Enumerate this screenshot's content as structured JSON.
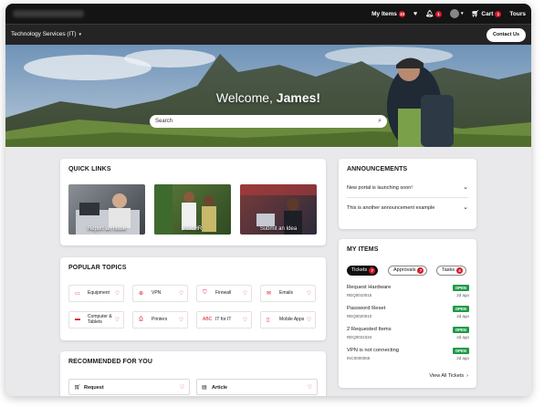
{
  "topbar": {
    "my_items_label": "My Items",
    "my_items_count": "10",
    "notif_count": "1",
    "cart_label": "Cart",
    "cart_count": "1",
    "tours_label": "Tours"
  },
  "subbar": {
    "department": "Technology Services (IT)",
    "contact_label": "Contact Us"
  },
  "hero": {
    "welcome_prefix": "Welcome,",
    "user_name": "James!",
    "search_placeholder": "Search"
  },
  "quick_links": {
    "title": "QUICK LINKS",
    "items": [
      {
        "label": "Report an Issue"
      },
      {
        "label": "Ask HR"
      },
      {
        "label": "Submit an Idea"
      }
    ]
  },
  "popular_topics": {
    "title": "POPULAR TOPICS",
    "items": [
      {
        "label": "Equipment",
        "icon": "monitor-icon"
      },
      {
        "label": "VPN",
        "icon": "globe-icon"
      },
      {
        "label": "Firewall",
        "icon": "shield-icon"
      },
      {
        "label": "Emails",
        "icon": "envelope-icon"
      },
      {
        "label": "Computer & Tablets",
        "icon": "laptop-icon"
      },
      {
        "label": "Printers",
        "icon": "printer-icon"
      },
      {
        "label": "IT for IT",
        "icon": "code-icon"
      },
      {
        "label": "Mobile Apps",
        "icon": "mobile-icon"
      }
    ]
  },
  "recommended": {
    "title": "RECOMMENDED FOR YOU",
    "items": [
      {
        "label": "Request",
        "icon": "cart-icon"
      },
      {
        "label": "Article",
        "icon": "document-icon"
      }
    ]
  },
  "announcements": {
    "title": "ANNOUNCEMENTS",
    "items": [
      {
        "label": "New portal is launching soon!"
      },
      {
        "label": "This is another announcement example"
      }
    ]
  },
  "my_items": {
    "title": "MY ITEMS",
    "tabs": [
      {
        "label": "Tickets",
        "count": "7"
      },
      {
        "label": "Approvals",
        "count": "7"
      },
      {
        "label": "Tasks",
        "count": "4"
      }
    ],
    "items": [
      {
        "name": "Request Hardware",
        "id": "REQ0010015",
        "status": "OPEN",
        "age": "2d ago"
      },
      {
        "name": "Password Reset",
        "id": "REQ0020010",
        "status": "OPEN",
        "age": "2d ago"
      },
      {
        "name": "2 Requested Items",
        "id": "REQ0031034",
        "status": "OPEN",
        "age": "2d ago"
      },
      {
        "name": "VPN is not connecting",
        "id": "INC0000065",
        "status": "OPEN",
        "age": "2d ago"
      }
    ],
    "view_all_label": "View All Tickets"
  },
  "colors": {
    "accent": "#d7192a",
    "open_status": "#1f9a4a",
    "topbar": "#141414"
  }
}
